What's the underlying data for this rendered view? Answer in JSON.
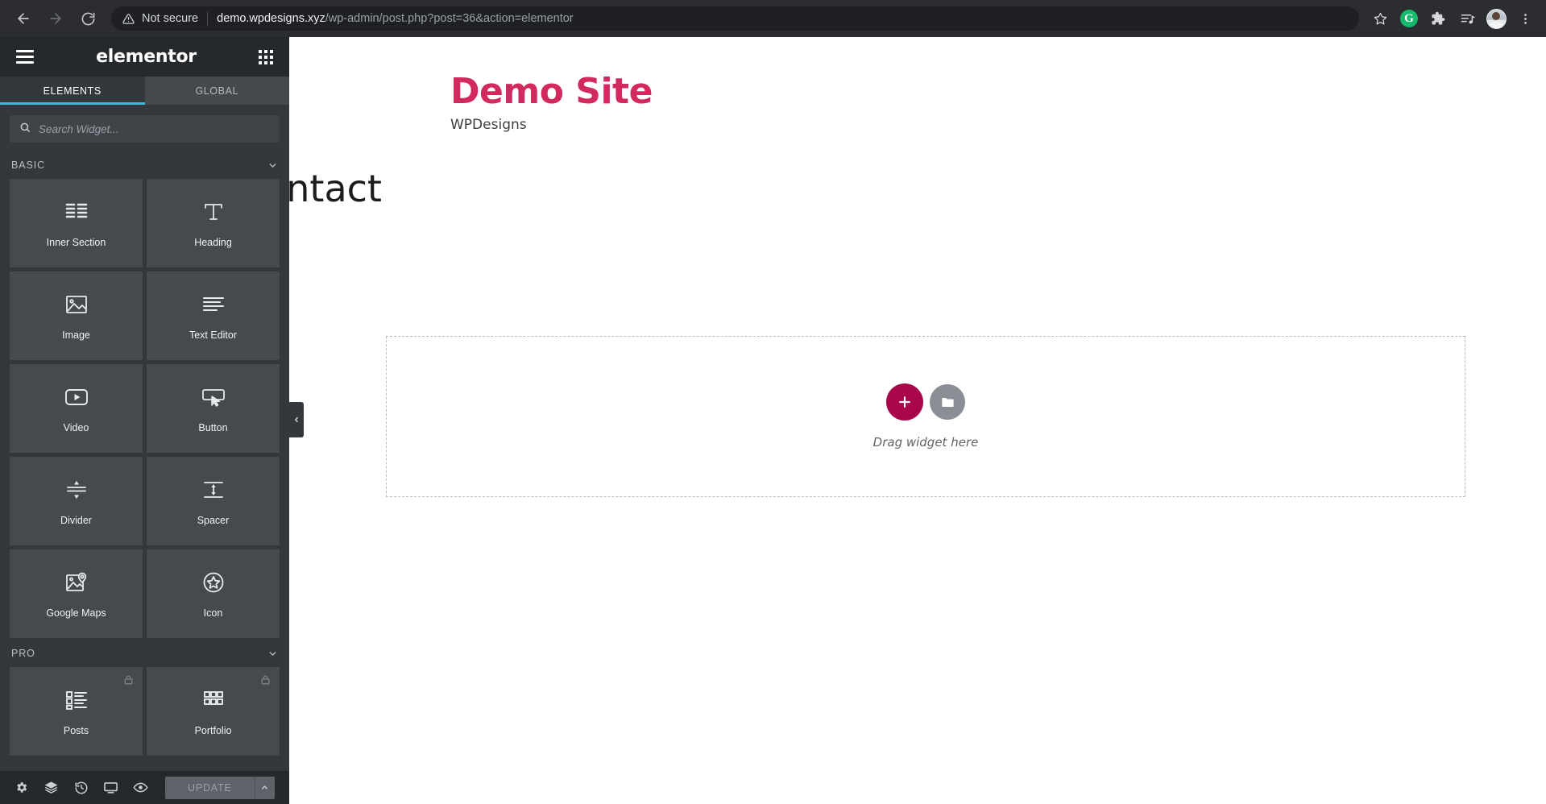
{
  "browser": {
    "back_label": "Back",
    "forward_label": "Forward",
    "reload_label": "Reload",
    "security_text": "Not secure",
    "url_host": "demo.wpdesigns.xyz",
    "url_path": "/wp-admin/post.php?post=36&action=elementor",
    "actions": {
      "bookmark": "Bookmark this page",
      "grammarly": "G",
      "extensions": "Extensions",
      "reading_list": "Reading list",
      "profile": "Profile",
      "menu": "Customize and control"
    }
  },
  "panel": {
    "brand": "elementor",
    "menu_label": "Menu",
    "apps_label": "Apps",
    "tabs": [
      {
        "label": "ELEMENTS",
        "active": true
      },
      {
        "label": "GLOBAL",
        "active": false
      }
    ],
    "search": {
      "placeholder": "Search Widget...",
      "value": ""
    },
    "categories": [
      {
        "name": "BASIC",
        "expanded": true,
        "widgets": [
          {
            "label": "Inner Section",
            "icon": "columns-icon",
            "locked": false
          },
          {
            "label": "Heading",
            "icon": "heading-t-icon",
            "locked": false
          },
          {
            "label": "Image",
            "icon": "image-icon",
            "locked": false
          },
          {
            "label": "Text Editor",
            "icon": "text-lines-icon",
            "locked": false
          },
          {
            "label": "Video",
            "icon": "video-play-icon",
            "locked": false
          },
          {
            "label": "Button",
            "icon": "button-cursor-icon",
            "locked": false
          },
          {
            "label": "Divider",
            "icon": "divider-icon",
            "locked": false
          },
          {
            "label": "Spacer",
            "icon": "spacer-icon",
            "locked": false
          },
          {
            "label": "Google Maps",
            "icon": "map-pin-icon",
            "locked": false
          },
          {
            "label": "Icon",
            "icon": "star-circle-icon",
            "locked": false
          }
        ]
      },
      {
        "name": "PRO",
        "expanded": true,
        "widgets": [
          {
            "label": "Posts",
            "icon": "posts-list-icon",
            "locked": true
          },
          {
            "label": "Portfolio",
            "icon": "portfolio-grid-icon",
            "locked": true
          }
        ]
      }
    ],
    "footer": {
      "icons": [
        {
          "name": "settings-gear-icon",
          "title": "Settings"
        },
        {
          "name": "navigator-layers-icon",
          "title": "Navigator"
        },
        {
          "name": "history-clock-icon",
          "title": "History"
        },
        {
          "name": "responsive-monitor-icon",
          "title": "Responsive Mode"
        },
        {
          "name": "preview-eye-icon",
          "title": "Preview Changes"
        }
      ],
      "update_label": "UPDATE",
      "update_caret": "Save Options"
    },
    "collapse_label": "Collapse panel"
  },
  "canvas": {
    "site_title": "Demo Site",
    "site_tagline": "WPDesigns",
    "page_title": "Contact",
    "dropzone": {
      "add_section_label": "Add New Section",
      "template_label": "Add Template",
      "hint": "Drag widget here"
    }
  },
  "colors": {
    "accent_pink": "#d22a5f",
    "add_button": "#a9054a",
    "tab_underline": "#42b6d5",
    "panel_bg": "#34383c",
    "panel_dark": "#26292c",
    "widget_bg": "#46494e"
  }
}
